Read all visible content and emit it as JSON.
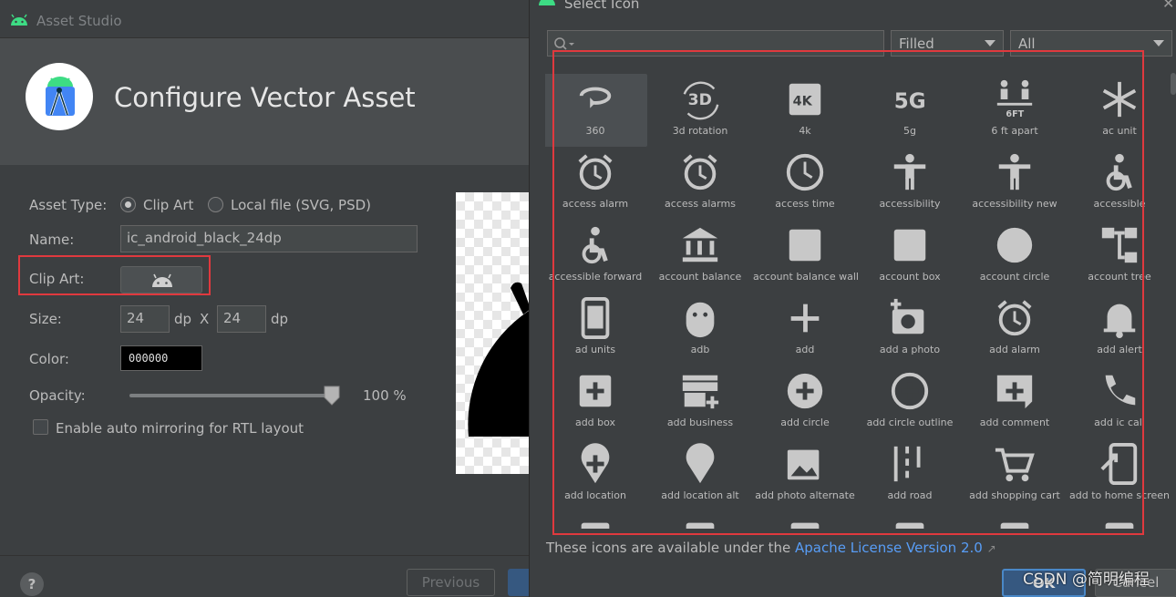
{
  "studio": {
    "window_title": "Asset Studio",
    "heading": "Configure Vector Asset",
    "asset_type_label": "Asset Type:",
    "asset_type_options": [
      "Clip Art",
      "Local file (SVG, PSD)"
    ],
    "asset_type_selected": "Clip Art",
    "name_label": "Name:",
    "name_value": "ic_android_black_24dp",
    "clip_art_label": "Clip Art:",
    "clip_art_icon": "android-icon",
    "size_label": "Size:",
    "width_value": "24",
    "height_value": "24",
    "unit_dp": "dp",
    "size_sep": "X",
    "color_label": "Color:",
    "color_value": "000000",
    "opacity_label": "Opacity:",
    "opacity_value": "100 %",
    "opacity_fraction": 1.0,
    "rtl_label": "Enable auto mirroring for RTL layout",
    "rtl_checked": false,
    "help_label": "?",
    "previous_label": "Previous"
  },
  "dialog": {
    "title": "Select Icon",
    "close": "✕",
    "search_placeholder": "",
    "style_value": "Filled",
    "category_value": "All",
    "icons": [
      {
        "name": "360",
        "icon": "360-icon"
      },
      {
        "name": "3d rotation",
        "icon": "3d-rotation-icon"
      },
      {
        "name": "4k",
        "icon": "4k-icon"
      },
      {
        "name": "5g",
        "icon": "5g-icon"
      },
      {
        "name": "6 ft apart",
        "icon": "6-ft-apart-icon"
      },
      {
        "name": "ac unit",
        "icon": "ac-unit-icon"
      },
      {
        "name": "access alarm",
        "icon": "access-alarm-icon"
      },
      {
        "name": "access alarms",
        "icon": "access-alarms-icon"
      },
      {
        "name": "access time",
        "icon": "access-time-icon"
      },
      {
        "name": "accessibility",
        "icon": "accessibility-icon"
      },
      {
        "name": "accessibility new",
        "icon": "accessibility-new-icon"
      },
      {
        "name": "accessible",
        "icon": "accessible-icon"
      },
      {
        "name": "accessible forward",
        "icon": "accessible-forward-icon"
      },
      {
        "name": "account balance",
        "icon": "account-balance-icon"
      },
      {
        "name": "account balance wall",
        "icon": "account-balance-wallet-icon"
      },
      {
        "name": "account box",
        "icon": "account-box-icon"
      },
      {
        "name": "account circle",
        "icon": "account-circle-icon"
      },
      {
        "name": "account tree",
        "icon": "account-tree-icon"
      },
      {
        "name": "ad units",
        "icon": "ad-units-icon"
      },
      {
        "name": "adb",
        "icon": "adb-icon"
      },
      {
        "name": "add",
        "icon": "add-icon"
      },
      {
        "name": "add a photo",
        "icon": "add-a-photo-icon"
      },
      {
        "name": "add alarm",
        "icon": "add-alarm-icon"
      },
      {
        "name": "add alert",
        "icon": "add-alert-icon"
      },
      {
        "name": "add box",
        "icon": "add-box-icon"
      },
      {
        "name": "add business",
        "icon": "add-business-icon"
      },
      {
        "name": "add circle",
        "icon": "add-circle-icon"
      },
      {
        "name": "add circle outline",
        "icon": "add-circle-outline-icon"
      },
      {
        "name": "add comment",
        "icon": "add-comment-icon"
      },
      {
        "name": "add ic call",
        "icon": "add-ic-call-icon"
      },
      {
        "name": "add location",
        "icon": "add-location-icon"
      },
      {
        "name": "add location alt",
        "icon": "add-location-alt-icon"
      },
      {
        "name": "add photo alternate",
        "icon": "add-photo-alternate-icon"
      },
      {
        "name": "add road",
        "icon": "add-road-icon"
      },
      {
        "name": "add shopping cart",
        "icon": "add-shopping-cart-icon"
      },
      {
        "name": "add to home screen",
        "icon": "add-to-home-screen-icon"
      }
    ],
    "selected_index": 0,
    "license_text": "These icons are available under the ",
    "license_link": "Apache License Version 2.0",
    "license_arrow": "↗",
    "ok_label": "OK",
    "cancel_label": "Cancel"
  },
  "watermark": "CSDN @简明编程",
  "colors": {
    "accent": "#365880",
    "highlight": "#e0393e",
    "link": "#589df6",
    "android_green": "#3ddc84"
  }
}
